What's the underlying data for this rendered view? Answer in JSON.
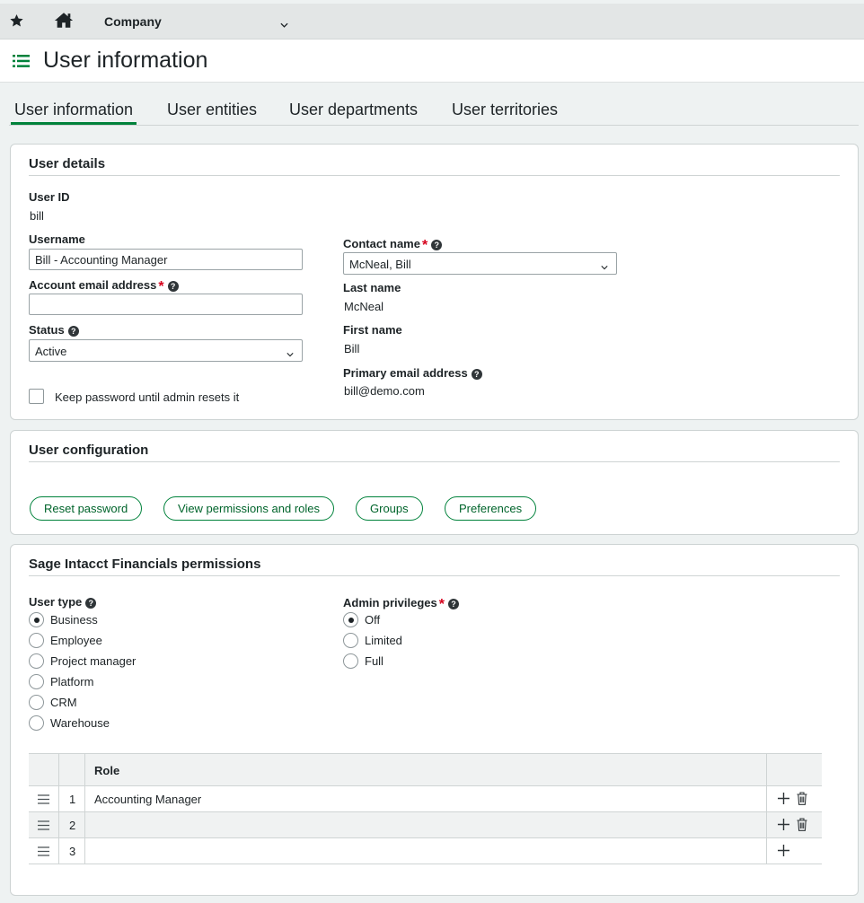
{
  "topbar": {
    "company": "Company"
  },
  "page": {
    "title": "User information"
  },
  "tabs": [
    {
      "label": "User information",
      "active": true
    },
    {
      "label": "User entities",
      "active": false
    },
    {
      "label": "User departments",
      "active": false
    },
    {
      "label": "User territories",
      "active": false
    }
  ],
  "user_details": {
    "section_title": "User details",
    "user_id_label": "User ID",
    "user_id_value": "bill",
    "username_label": "Username",
    "username_value": "Bill - Accounting Manager",
    "email_label": "Account email address",
    "email_value": "",
    "status_label": "Status",
    "status_value": "Active",
    "keep_password_label": "Keep password until admin resets it",
    "keep_password_checked": false,
    "contact_name_label": "Contact name",
    "contact_name_value": "McNeal, Bill",
    "last_name_label": "Last name",
    "last_name_value": "McNeal",
    "first_name_label": "First name",
    "first_name_value": "Bill",
    "primary_email_label": "Primary email address",
    "primary_email_value": "bill@demo.com"
  },
  "user_configuration": {
    "section_title": "User configuration",
    "buttons": [
      "Reset password",
      "View permissions and roles",
      "Groups",
      "Preferences"
    ]
  },
  "financials_permissions": {
    "section_title": "Sage Intacct Financials permissions",
    "user_type_label": "User type",
    "user_types": [
      {
        "label": "Business",
        "checked": true
      },
      {
        "label": "Employee",
        "checked": false
      },
      {
        "label": "Project manager",
        "checked": false
      },
      {
        "label": "Platform",
        "checked": false
      },
      {
        "label": "CRM",
        "checked": false
      },
      {
        "label": "Warehouse",
        "checked": false
      }
    ],
    "admin_label": "Admin privileges",
    "admin_options": [
      {
        "label": "Off",
        "checked": true
      },
      {
        "label": "Limited",
        "checked": false
      },
      {
        "label": "Full",
        "checked": false
      }
    ],
    "roles_grid": {
      "header": "Role",
      "rows": [
        {
          "num": "1",
          "role": "Accounting Manager"
        },
        {
          "num": "2",
          "role": ""
        },
        {
          "num": "3",
          "role": ""
        }
      ]
    }
  },
  "colors": {
    "accent": "#00823b",
    "required": "#d6001c"
  }
}
